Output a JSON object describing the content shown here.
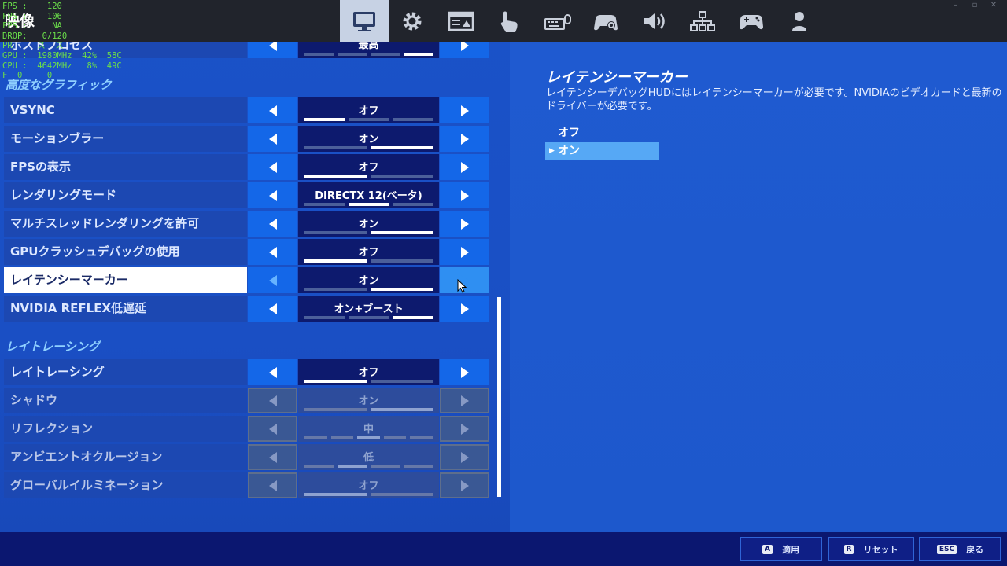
{
  "page_title": "映像",
  "fps_overlay": [
    "FPS :    120",
    "FPS :    106",
    "FPS :     NA",
    "DROP:   0/120",
    "PR     ス  ス",
    "GPU :  1980MHz  42%  58C",
    "CPU :  4642MHz   8%  49C",
    "F  0     0"
  ],
  "tabs": [
    {
      "icon": "monitor-icon",
      "active": true
    },
    {
      "icon": "gear-icon",
      "active": false
    },
    {
      "icon": "window-icon",
      "active": false
    },
    {
      "icon": "touch-icon",
      "active": false
    },
    {
      "icon": "keyboard-mouse-icon",
      "active": false
    },
    {
      "icon": "controller-settings-icon",
      "active": false
    },
    {
      "icon": "speaker-icon",
      "active": false
    },
    {
      "icon": "network-icon",
      "active": false
    },
    {
      "icon": "gamepad-icon",
      "active": false
    },
    {
      "icon": "user-icon",
      "active": false
    }
  ],
  "partial_row": {
    "label": "ポストプロセス",
    "value": "最高"
  },
  "section_advanced": "高度なグラフィック",
  "advanced_rows": [
    {
      "label": "VSYNC",
      "value": "オフ",
      "segments": 3,
      "active": 0
    },
    {
      "label": "モーションブラー",
      "value": "オン",
      "segments": 2,
      "active": 1
    },
    {
      "label": "FPSの表示",
      "value": "オフ",
      "segments": 2,
      "active": 0
    },
    {
      "label": "レンダリングモード",
      "value": "DIRECTX 12(ベータ)",
      "segments": 3,
      "active": 1
    },
    {
      "label": "マルチスレッドレンダリングを許可",
      "value": "オン",
      "segments": 2,
      "active": 1
    },
    {
      "label": "GPUクラッシュデバッグの使用",
      "value": "オフ",
      "segments": 2,
      "active": 0
    },
    {
      "label": "レイテンシーマーカー",
      "value": "オン",
      "segments": 2,
      "active": 1
    },
    {
      "label": "NVIDIA REFLEX低遅延",
      "value": "オン+ブースト",
      "segments": 3,
      "active": 2
    }
  ],
  "section_rt": "レイトレーシング",
  "rt_rows": [
    {
      "label": "レイトレーシング",
      "value": "オフ",
      "segments": 2,
      "active": 0
    },
    {
      "label": "シャドウ",
      "value": "オン",
      "segments": 2,
      "active": 1
    },
    {
      "label": "リフレクション",
      "value": "中",
      "segments": 5,
      "active": 2
    },
    {
      "label": "アンビエントオクルージョン",
      "value": "低",
      "segments": 4,
      "active": 1
    },
    {
      "label": "グローバルイルミネーション",
      "value": "オフ",
      "segments": 2,
      "active": 0
    }
  ],
  "description": {
    "title": "レイテンシーマーカー",
    "text": "レイテンシーデバッグHUDにはレイテンシーマーカーが必要です。NVIDIAのビデオカードと最新のドライバーが必要です。",
    "options": [
      "オフ",
      "オン"
    ],
    "selected": 1
  },
  "bottom": {
    "apply_key": "A",
    "apply_label": "適用",
    "reset_key": "R",
    "reset_label": "リセット",
    "back_key": "ESC",
    "back_label": "戻る"
  }
}
